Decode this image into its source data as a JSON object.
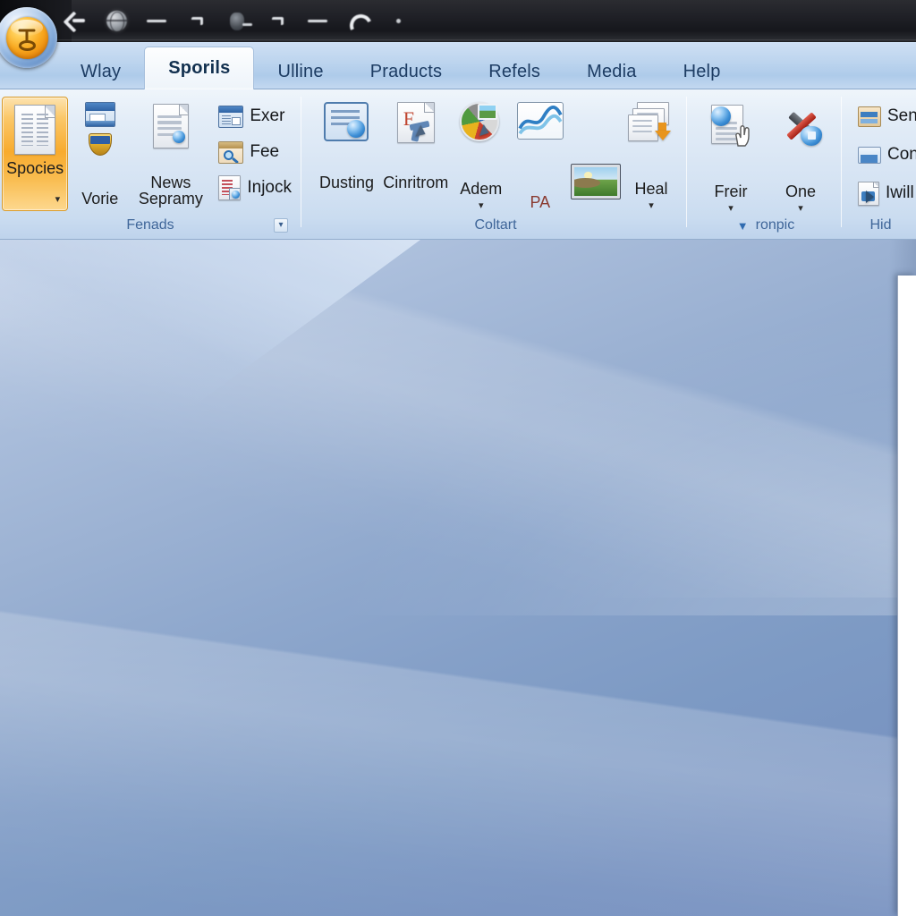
{
  "window": {
    "titlebar": {
      "quick_access": [
        {
          "name": "back-icon",
          "label": "Back"
        },
        {
          "name": "globe-icon",
          "label": "Globe"
        },
        {
          "name": "dash-icon",
          "label": "Dash"
        },
        {
          "name": "tick-icon",
          "label": "Tick"
        },
        {
          "name": "blob-icon",
          "label": "Blob"
        },
        {
          "name": "tick2-icon",
          "label": "Tick"
        },
        {
          "name": "dash2-icon",
          "label": "Dash"
        },
        {
          "name": "undo-icon",
          "label": "Undo"
        },
        {
          "name": "dot-icon",
          "label": "Dot"
        }
      ]
    },
    "office_button": {
      "label": "Office"
    }
  },
  "tabs": [
    {
      "label": "Wlay",
      "active": false
    },
    {
      "label": "Sporils",
      "active": true
    },
    {
      "label": "Ulline",
      "active": false
    },
    {
      "label": "Praducts",
      "active": false
    },
    {
      "label": "Refels",
      "active": false
    },
    {
      "label": "Media",
      "active": false
    },
    {
      "label": "Help",
      "active": false
    }
  ],
  "ribbon": {
    "groups": [
      {
        "name": "fenads",
        "label": "Fenads",
        "has_dialog_launcher": true,
        "dialog_launcher_glyph": "▾",
        "big_button": {
          "label": "Spocies",
          "caret": "▾",
          "selected": true
        },
        "med_buttons": [
          {
            "label": "Vorie",
            "icon": "window-shield-icon"
          },
          {
            "label": "News Sepramy",
            "icon": "document-blue-dot-icon"
          }
        ],
        "small_buttons": [
          {
            "label": "Exer",
            "icon": "blue-window-icon"
          },
          {
            "label": "Fee",
            "icon": "magnifier-window-icon"
          },
          {
            "label": "Injock",
            "icon": "clipboard-search-icon"
          }
        ]
      },
      {
        "name": "coltart",
        "label": "Coltart",
        "has_dialog_launcher": false,
        "buttons": [
          {
            "label": "Dusting",
            "icon": "doc-bluedot-icon",
            "caret": ""
          },
          {
            "label": "Cinritrom",
            "icon": "doc-transform-icon",
            "caret": ""
          },
          {
            "label": "Adem",
            "icon": "pie-chart-icon",
            "caret": "▾"
          },
          {
            "label": "PA",
            "icon": "wave-chart-icon",
            "caret": ""
          },
          {
            "label": "Heal",
            "icon": "stack-download-icon",
            "caret": "▾"
          }
        ],
        "gallery_thumb": {
          "name": "photo-thumbnail",
          "label": "Photo"
        }
      },
      {
        "name": "ronpic",
        "label": "ronpic",
        "label_caret": "▼",
        "has_dialog_launcher": false,
        "buttons": [
          {
            "label": "Freir",
            "icon": "signed-doc-hand-icon",
            "caret": "▾"
          },
          {
            "label": "One",
            "icon": "tools-shield-icon",
            "caret": "▾"
          }
        ]
      },
      {
        "name": "hid",
        "label": "Hid",
        "clipped": true,
        "small_buttons": [
          {
            "label": "Sen",
            "icon": "send-tray-icon"
          },
          {
            "label": "Con",
            "icon": "blue-folder-icon"
          },
          {
            "label": "Iwill",
            "icon": "export-doc-icon"
          }
        ]
      }
    ]
  },
  "workspace": {
    "document_panel": {
      "name": "document-page",
      "visible": true
    }
  },
  "colors": {
    "ribbon_top": "#eff5fb",
    "ribbon_bottom": "#bed3ec",
    "tabstrip": "#bcd4ee",
    "active_tab": "#fdfefe",
    "group_label": "#3f6699",
    "selected_button": "#f8ab2e",
    "desktop_blue": "#7b96c4",
    "titlebar": "#1b1c21"
  }
}
